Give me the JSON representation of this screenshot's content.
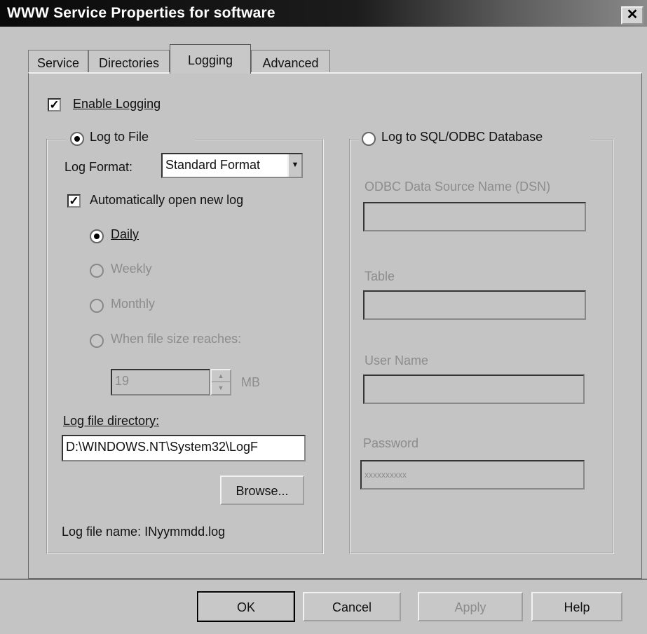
{
  "window": {
    "title": "WWW Service Properties for software",
    "close_glyph": "✕"
  },
  "tabs": [
    {
      "label": "Service",
      "active": false
    },
    {
      "label": "Directories",
      "active": false
    },
    {
      "label": "Logging",
      "active": true
    },
    {
      "label": "Advanced",
      "active": false
    }
  ],
  "logging": {
    "enable_label": "Enable Logging",
    "enable_checked": true,
    "file_group": {
      "radio_label": "Log to File",
      "selected": true,
      "format_label": "Log Format:",
      "format_value": "Standard Format",
      "auto_open_label": "Automatically open new log",
      "auto_open_checked": true,
      "period_options": [
        {
          "label": "Daily",
          "selected": true,
          "enabled": true
        },
        {
          "label": "Weekly",
          "selected": false,
          "enabled": false
        },
        {
          "label": "Monthly",
          "selected": false,
          "enabled": false
        },
        {
          "label": "When file size reaches:",
          "selected": false,
          "enabled": false
        }
      ],
      "size_value": "19",
      "size_unit": "MB",
      "directory_label": "Log file directory:",
      "directory_value": "D:\\WINDOWS.NT\\System32\\LogF",
      "browse_label": "Browse...",
      "file_name_text": "Log file name: INyymmdd.log"
    },
    "sql_group": {
      "radio_label": "Log to SQL/ODBC Database",
      "selected": false,
      "dsn_label": "ODBC Data Source Name (DSN)",
      "table_label": "Table",
      "user_label": "User Name",
      "password_label": "Password",
      "password_mask": "xxxxxxxxxx"
    }
  },
  "buttons": {
    "ok": "OK",
    "cancel": "Cancel",
    "apply": "Apply",
    "help": "Help"
  }
}
